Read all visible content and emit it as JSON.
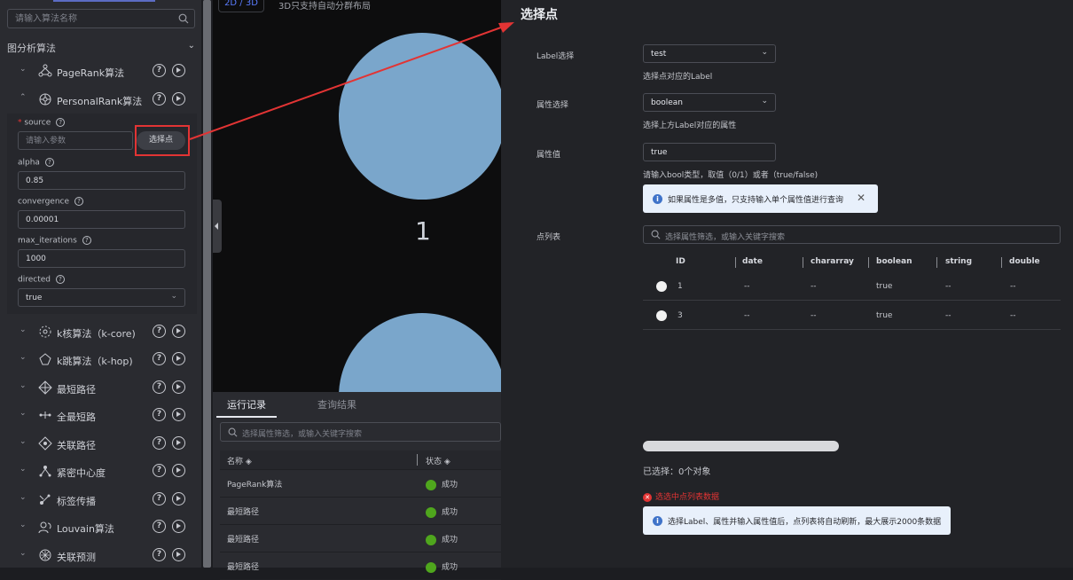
{
  "sidebar": {
    "search_placeholder": "请输入算法名称",
    "group_title": "图分析算法",
    "algorithms": [
      {
        "name": "PageRank算法",
        "icon": "pagerank-icon",
        "expanded": false
      },
      {
        "name": "PersonalRank算法",
        "icon": "personalrank-icon",
        "expanded": true
      },
      {
        "name": "k核算法（k-core)",
        "icon": "k-core-icon",
        "expanded": false
      },
      {
        "name": "k跳算法（k-hop)",
        "icon": "k-hop-icon",
        "expanded": false
      },
      {
        "name": "最短路径",
        "icon": "shortest-path-icon",
        "expanded": false
      },
      {
        "name": "全最短路",
        "icon": "all-shortest-paths-icon",
        "expanded": false
      },
      {
        "name": "关联路径",
        "icon": "related-path-icon",
        "expanded": false
      },
      {
        "name": "紧密中心度",
        "icon": "closeness-icon",
        "expanded": false
      },
      {
        "name": "标签传播",
        "icon": "label-propagation-icon",
        "expanded": false
      },
      {
        "name": "Louvain算法",
        "icon": "louvain-icon",
        "expanded": false
      },
      {
        "name": "关联预测",
        "icon": "link-prediction-icon",
        "expanded": false
      }
    ],
    "params": {
      "source_label": "source",
      "source_placeholder": "请输入参数",
      "pick_button": "选择点",
      "alpha_label": "alpha",
      "alpha_value": "0.85",
      "convergence_label": "convergence",
      "convergence_value": "0.00001",
      "max_iterations_label": "max_iterations",
      "max_iterations_value": "1000",
      "directed_label": "directed",
      "directed_value": "true"
    }
  },
  "canvas": {
    "view_toggle": "2D / 3D",
    "note": "3D只支持自动分群布局",
    "node_label": "1",
    "node_color": "#7aa6cb"
  },
  "bottom_panel": {
    "tabs": [
      "运行记录",
      "查询结果"
    ],
    "search_placeholder": "选择属性筛选，或输入关键字搜索",
    "columns": [
      "名称",
      "状态"
    ],
    "rows": [
      {
        "name": "PageRank算法",
        "status": "成功"
      },
      {
        "name": "最短路径",
        "status": "成功"
      },
      {
        "name": "最短路径",
        "status": "成功"
      },
      {
        "name": "最短路径",
        "status": "成功"
      }
    ]
  },
  "dialog": {
    "title": "选择点",
    "label_select": {
      "label": "Label选择",
      "value": "test",
      "hint": "选择点对应的Label"
    },
    "prop_select": {
      "label": "属性选择",
      "value": "boolean",
      "hint": "选择上方Label对应的属性"
    },
    "prop_value": {
      "label": "属性值",
      "value": "true",
      "hint": "请输入bool类型，取值（0/1）或者（true/false)"
    },
    "multi_value_info": "如果属性是多值，只支持输入单个属性值进行查询",
    "vertex_list": {
      "label": "点列表",
      "search_placeholder": "选择属性筛选，或输入关键字搜索",
      "columns": [
        "ID",
        "date",
        "chararray",
        "boolean",
        "string",
        "double"
      ],
      "rows": [
        [
          "1",
          "--",
          "--",
          "true",
          "--",
          "--"
        ],
        [
          "3",
          "--",
          "--",
          "true",
          "--",
          "--"
        ]
      ]
    },
    "selected_text": "已选择：0个对象",
    "error_text": "选选中点列表数据",
    "bottom_info": "选择Label、属性并输入属性值后，点列表将自动刷新，最大展示2000条数据",
    "accent_red": "#e23434",
    "success_green": "#4fa61d",
    "info_blue": "#3f73c9"
  }
}
